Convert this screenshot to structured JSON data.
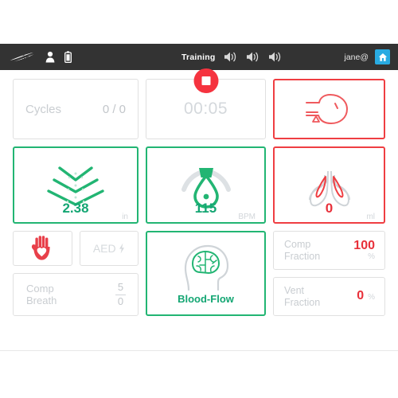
{
  "header": {
    "logo_icon": "3b-logo-icon",
    "manikin_icon": "manikin-icon",
    "battery_icon": "battery-icon",
    "mode_label": "Training",
    "speaker_icons": [
      "speaker-icon-1",
      "speaker-icon-2",
      "speaker-icon-3"
    ],
    "user_label": "jane@",
    "home_icon": "home-icon",
    "bar_color": "#333333",
    "home_button_color": "#29abe2"
  },
  "cards": {
    "cycles": {
      "label": "Cycles",
      "value": "0 / 0"
    },
    "timer": {
      "value": "00:05",
      "stop_button_icon": "stop-square-icon",
      "stop_button_color": "#f5333f"
    },
    "airway": {
      "icon": "head-airway-icon",
      "status_color": "#ef3e42"
    },
    "depth": {
      "icon": "compression-chevrons-icon",
      "value": "2.38",
      "unit": "in",
      "status_color": "#22b573"
    },
    "rate": {
      "icon": "metronome-icon",
      "value": "115",
      "unit": "BPM",
      "status_color": "#22b573"
    },
    "volume": {
      "icon": "lungs-icon",
      "value": "0",
      "unit": "ml",
      "status_color": "#ef3e42"
    },
    "hand": {
      "icon": "hand-heart-icon"
    },
    "aed": {
      "label": "AED",
      "icon": "lightning-bolt-icon"
    },
    "comp_breath": {
      "label_top": "Comp",
      "label_bottom": "Breath",
      "value_top": "5",
      "value_bottom": "0"
    },
    "blood_flow": {
      "icon": "brain-head-icon",
      "label": "Blood-Flow",
      "status_color": "#22b573"
    },
    "comp_fraction": {
      "label_top": "Comp",
      "label_bottom": "Fraction",
      "value": "100",
      "unit": "%"
    },
    "vent_fraction": {
      "label_top": "Vent",
      "label_bottom": "Fraction",
      "value": "0",
      "unit": "%"
    }
  }
}
